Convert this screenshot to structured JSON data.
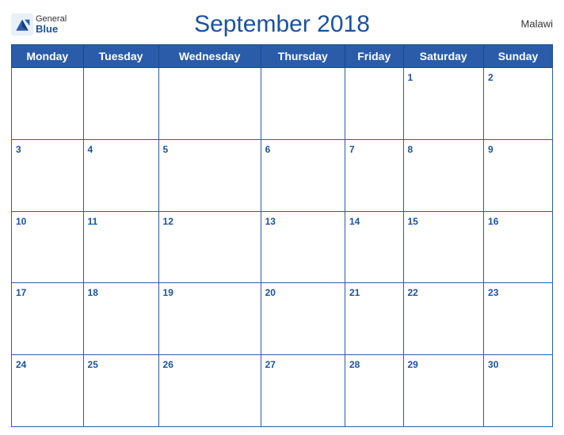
{
  "header": {
    "title": "September 2018",
    "country": "Malawi",
    "logo_general": "General",
    "logo_blue": "Blue"
  },
  "days": [
    "Monday",
    "Tuesday",
    "Wednesday",
    "Thursday",
    "Friday",
    "Saturday",
    "Sunday"
  ],
  "weeks": [
    [
      null,
      null,
      null,
      null,
      null,
      1,
      2
    ],
    [
      3,
      4,
      5,
      6,
      7,
      8,
      9
    ],
    [
      10,
      11,
      12,
      13,
      14,
      15,
      16
    ],
    [
      17,
      18,
      19,
      20,
      21,
      22,
      23
    ],
    [
      24,
      25,
      26,
      27,
      28,
      29,
      30
    ]
  ]
}
